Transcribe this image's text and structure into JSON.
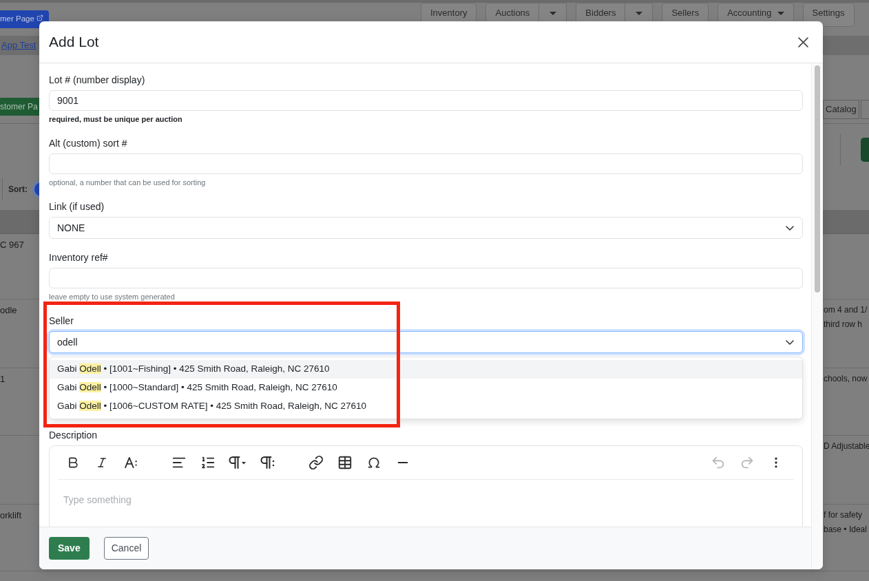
{
  "background_page": {
    "customer_page_button": "mer Page",
    "nav": [
      {
        "label": "Inventory",
        "kind": "button"
      },
      {
        "label": "Auctions",
        "kind": "split"
      },
      {
        "label": "Bidders",
        "kind": "split"
      },
      {
        "label": "Sellers",
        "kind": "button"
      },
      {
        "label": "Accounting",
        "kind": "dropdown"
      },
      {
        "label": "Settings",
        "kind": "button"
      }
    ],
    "test_link": "App Test",
    "customer_page_button_2": "stomer Pa",
    "catalog_tab": "Catalog",
    "sort_label": "Sort:",
    "table": {
      "rows": [
        {
          "column_1": "C 967"
        },
        {
          "column_1": "odle",
          "column_2": [
            "om 4 and 1/",
            "third row h"
          ]
        },
        {
          "column_1": "1",
          "column_2": [
            "chools, now"
          ]
        },
        {
          "column_2": [
            "D Adjustable"
          ]
        },
        {
          "column_1": "orklift",
          "column_2": [
            "f for safety",
            "base • Ideal"
          ]
        }
      ]
    }
  },
  "modal": {
    "title": "Add Lot",
    "fields": [
      {
        "kind": "text",
        "label": "Lot # (number display)",
        "value": "9001",
        "help": "required, must be unique per auction",
        "help_bold": true,
        "focused": false
      },
      {
        "kind": "text",
        "label": "Alt (custom) sort #",
        "help": "optional, a number that can be used for sorting",
        "help_bold": false,
        "focused": false
      },
      {
        "kind": "select",
        "label": "Link (if used)",
        "value": "NONE",
        "focused": false
      },
      {
        "kind": "text",
        "label": "Inventory ref#",
        "help": "leave empty to use system generated",
        "help_bold": false,
        "focused": false
      },
      {
        "kind": "combobox",
        "label": "Seller",
        "value": "odell",
        "focused": true,
        "options": [
          {
            "before": "Gabi ",
            "match": "Odell",
            "after": " • [1001~Fishing] • 425 Smith Road, Raleigh, NC 27610",
            "selected": true
          },
          {
            "before": "Gabi ",
            "match": "Odell",
            "after": " • [1000~Standard] • 425 Smith Road, Raleigh, NC 27610",
            "selected": false
          },
          {
            "before": "Gabi ",
            "match": "Odell",
            "after": " • [1006~CUSTOM RATE] • 425 Smith Road, Raleigh, NC 27610",
            "selected": false
          }
        ]
      },
      {
        "kind": "editor",
        "label": "Description",
        "placeholder": "Type something",
        "toolbar": [
          {
            "items": [
              {
                "kind": "bold",
                "disabled": false
              },
              {
                "kind": "italic",
                "disabled": false
              },
              {
                "kind": "font_size",
                "disabled": false
              }
            ]
          },
          {
            "items": [
              {
                "kind": "align",
                "disabled": false
              },
              {
                "kind": "ordered_list",
                "disabled": false
              },
              {
                "kind": "paragraph_style",
                "disabled": false
              },
              {
                "kind": "paragraph_format",
                "disabled": false
              }
            ]
          },
          {
            "items": [
              {
                "kind": "link",
                "disabled": false
              },
              {
                "kind": "table",
                "disabled": false
              },
              {
                "kind": "special_char",
                "disabled": false
              },
              {
                "kind": "horizontal_rule",
                "disabled": false
              }
            ]
          },
          {
            "items": [
              {
                "kind": "undo",
                "disabled": true
              },
              {
                "kind": "redo",
                "disabled": true
              },
              {
                "kind": "more",
                "disabled": false
              }
            ]
          }
        ]
      }
    ],
    "buttons": [
      {
        "label": "Save",
        "kind": "primary"
      },
      {
        "label": "Cancel",
        "kind": "secondary"
      }
    ]
  },
  "annotation": {
    "kind": "frame"
  }
}
